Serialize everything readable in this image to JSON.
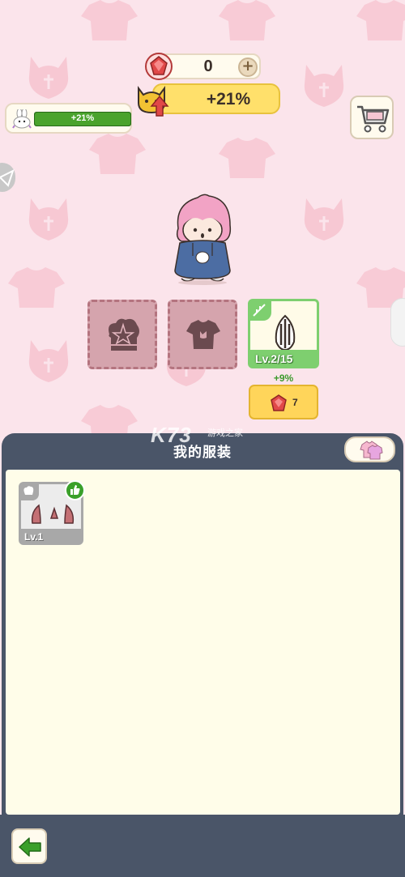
{
  "currency": {
    "gems": "0",
    "icon": "red-gem-icon",
    "add_icon": "plus-icon"
  },
  "boost": {
    "value": "+21%",
    "icon": "devil-cat-boost-icon"
  },
  "progress": {
    "label": "+21%",
    "fill_fraction": 1.0,
    "icon": "bunny-icon"
  },
  "shop": {
    "icon": "shopping-cart-icon"
  },
  "slots": {
    "hat_icon": "chef-hat-pentagram-icon",
    "shirt_icon": "shirt-icon",
    "equipped": {
      "icon": "sunflower-seed-icon",
      "level": "Lv.2/15",
      "bonus": "+9%",
      "upgrade_cost": "7",
      "upgrade_icon": "red-gem-icon"
    }
  },
  "wardrobe": {
    "title": "我的服装",
    "items": [
      {
        "icon": "devil-horns-icon",
        "level": "Lv.1",
        "badge_icon": "thumbs-up-icon"
      }
    ]
  },
  "watermark": {
    "logo": "K73",
    "text": "游戏之家"
  },
  "colors": {
    "background": "#fbe4eb",
    "panel": "#4a5568",
    "panel_body": "#fffde9",
    "accent_yellow": "#ffe06b",
    "accent_green": "#7ecf6f"
  }
}
